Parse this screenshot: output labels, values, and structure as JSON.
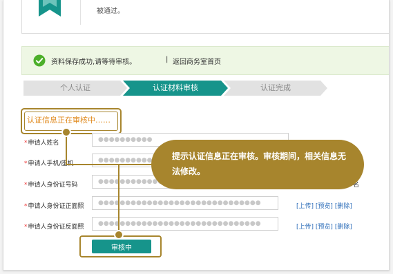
{
  "top_card": {
    "text": "被通过。"
  },
  "success_bar": {
    "message": "资料保存成功,请等待审核。",
    "separator": "|",
    "link_label": "返回商务室首页"
  },
  "steps": [
    {
      "label": "个人认证",
      "state": "done"
    },
    {
      "label": "认证材料审核",
      "state": "active"
    },
    {
      "label": "认证完成",
      "state": "pending"
    }
  ],
  "status": {
    "text": "认证信息正在审核中……"
  },
  "form": {
    "required_mark": "*",
    "fields": [
      {
        "label": "申请人姓名",
        "value": "●●●●●●●●●●"
      },
      {
        "label": "申请人手机/座机",
        "value": "●●●●●●●●●●●"
      },
      {
        "label": "申请人身份证号码",
        "value": "●●●●●●●●●●●●●●●●●●"
      },
      {
        "label": "申请人身份证正面照",
        "value": "●●●●●●●●●●●●●●●●●●●●●●●●●●●●●●"
      },
      {
        "label": "申请人身份证反面照",
        "value": "●●●●●●●●●●●●●●●●●●●●●●●●●●●●●●"
      }
    ],
    "photo_actions": {
      "upload": "[上传]",
      "preview": "[预览]",
      "delete": "[删除]"
    },
    "trailing_char": "名"
  },
  "tooltip": {
    "text": "提示认证信息正在审核。审核期间，相关信息无法修改。"
  },
  "submit": {
    "label": "审核中"
  },
  "colors": {
    "accent_gold": "#a7852d",
    "teal": "#16948b",
    "success_green": "#4caf2a",
    "link_blue": "#2b6cb8",
    "status_orange": "#e08a1e"
  }
}
